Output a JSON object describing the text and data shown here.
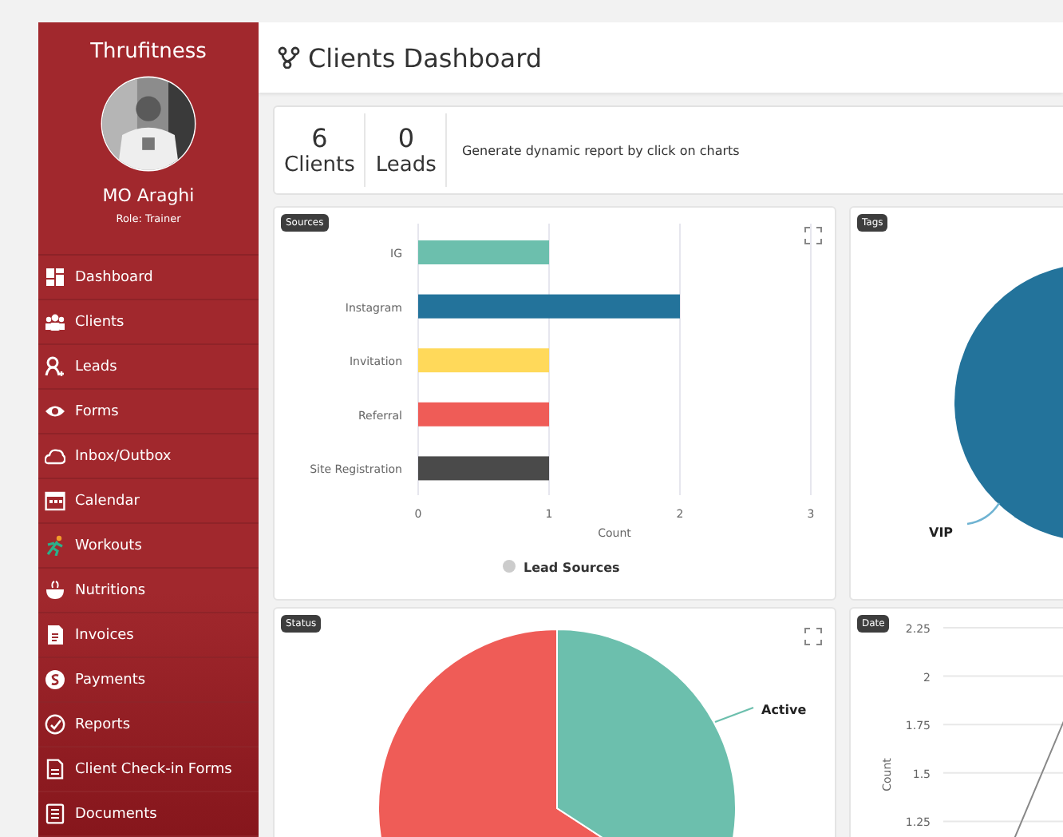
{
  "sidebar": {
    "brand": "Thrufitness",
    "user": {
      "name": "MO Araghi",
      "role": "Role: Trainer"
    },
    "items": [
      {
        "label": "Dashboard",
        "selected": false
      },
      {
        "label": "Clients",
        "selected": false
      },
      {
        "label": "Leads",
        "selected": false
      },
      {
        "label": "Forms",
        "selected": false
      },
      {
        "label": "Inbox/Outbox",
        "selected": false
      },
      {
        "label": "Calendar",
        "selected": false
      },
      {
        "label": "Workouts",
        "selected": false
      },
      {
        "label": "Nutritions",
        "selected": false
      },
      {
        "label": "Invoices",
        "selected": false
      },
      {
        "label": "Payments",
        "selected": false
      },
      {
        "label": "Reports",
        "selected": false
      },
      {
        "label": "Client Check-in Forms",
        "selected": false
      },
      {
        "label": "Documents",
        "selected": false
      }
    ]
  },
  "header": {
    "title": "Clients Dashboard"
  },
  "stats": [
    {
      "value": "6",
      "label": "Clients"
    },
    {
      "value": "0",
      "label": "Leads"
    }
  ],
  "stats_note": "Generate dynamic report by click on charts",
  "sources": {
    "badge": "Sources",
    "chart_data": {
      "type": "bar",
      "orientation": "horizontal",
      "categories": [
        "IG",
        "Instagram",
        "Invitation",
        "Referral",
        "Site Registration"
      ],
      "series": [
        {
          "name": "Lead Sources",
          "values": [
            1,
            2,
            1,
            1,
            1
          ]
        }
      ],
      "xlabel": "Count",
      "xlim": [
        0,
        3
      ],
      "xticks": [
        0,
        1,
        2,
        3
      ]
    }
  },
  "tags": {
    "badge": "Tags",
    "slice_label": "VIP"
  },
  "status": {
    "badge": "Status",
    "slice_label": "Active"
  },
  "date": {
    "badge": "Date",
    "ylabel": "Count",
    "yticks": [
      "2.25",
      "2",
      "1.75",
      "1.5",
      "1.25"
    ]
  }
}
